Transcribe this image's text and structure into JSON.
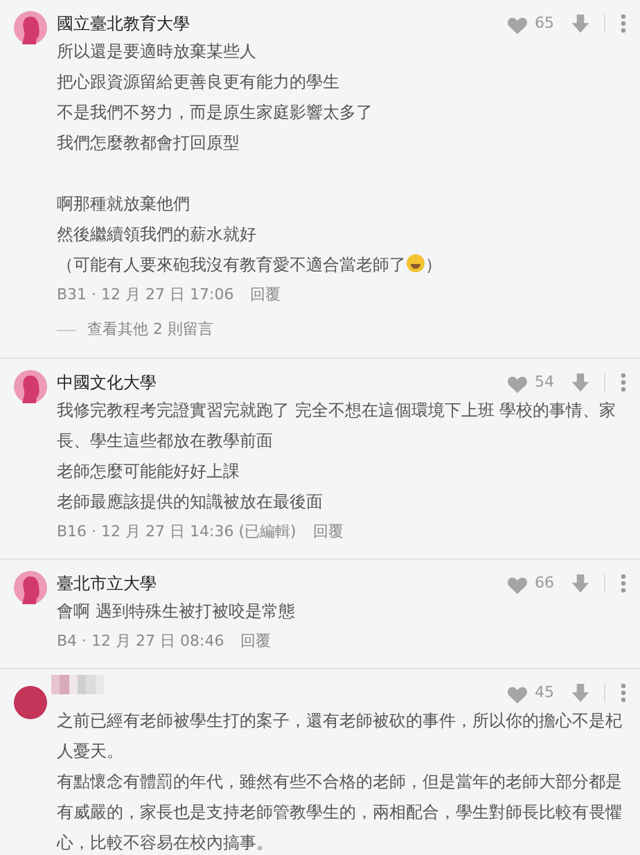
{
  "comments": [
    {
      "kind": "silhouette",
      "name": "國立臺北教育大學",
      "likes": "65",
      "lines": [
        {
          "text": "所以還是要適時放棄某些人"
        },
        {
          "text": "把心跟資源留給更善良更有能力的學生"
        },
        {
          "text": "不是我們不努力，而是原生家庭影響太多了"
        },
        {
          "text": "我們怎麼教都會打回原型"
        },
        {
          "kind": "blank"
        },
        {
          "text": "啊那種就放棄他們"
        },
        {
          "text": "然後繼續領我們的薪水就好"
        },
        {
          "text": "（可能有人要來砲我沒有教育愛不適合當老師了",
          "emoji": true,
          "after": "）"
        }
      ],
      "meta": "B31 · 12 月 27 日 17:06",
      "reply": "回覆",
      "more_replies": "查看其他 2 則留言"
    },
    {
      "kind": "silhouette",
      "name": "中國文化大學",
      "likes": "54",
      "lines": [
        {
          "text": "我修完教程考完證實習完就跑了 完全不想在這個環境下上班 學校的事情、家長、學生這些都放在教學前面"
        },
        {
          "text": "老師怎麼可能能好好上課"
        },
        {
          "text": "老師最應該提供的知識被放在最後面"
        }
      ],
      "meta": "B16 · 12 月 27 日 14:36 (已編輯)",
      "reply": "回覆"
    },
    {
      "kind": "silhouette",
      "name": "臺北市立大學",
      "likes": "66",
      "lines": [
        {
          "text": "會啊 遇到特殊生被打被咬是常態"
        }
      ],
      "meta": "B4 · 12 月 27 日 08:46",
      "reply": "回覆"
    },
    {
      "kind": "hidden",
      "likes": "45",
      "lines": [
        {
          "text": "之前已經有老師被學生打的案子，還有老師被砍的事件，所以你的擔心不是杞人憂天。"
        },
        {
          "text": "有點懷念有體罰的年代，雖然有些不合格的老師，但是當年的老師大部分都是有威嚴的，家長也是支持老師管教學生的，兩相配合，學生對師長比較有畏懼心，比較不容易在校內搞事。"
        }
      ]
    }
  ]
}
